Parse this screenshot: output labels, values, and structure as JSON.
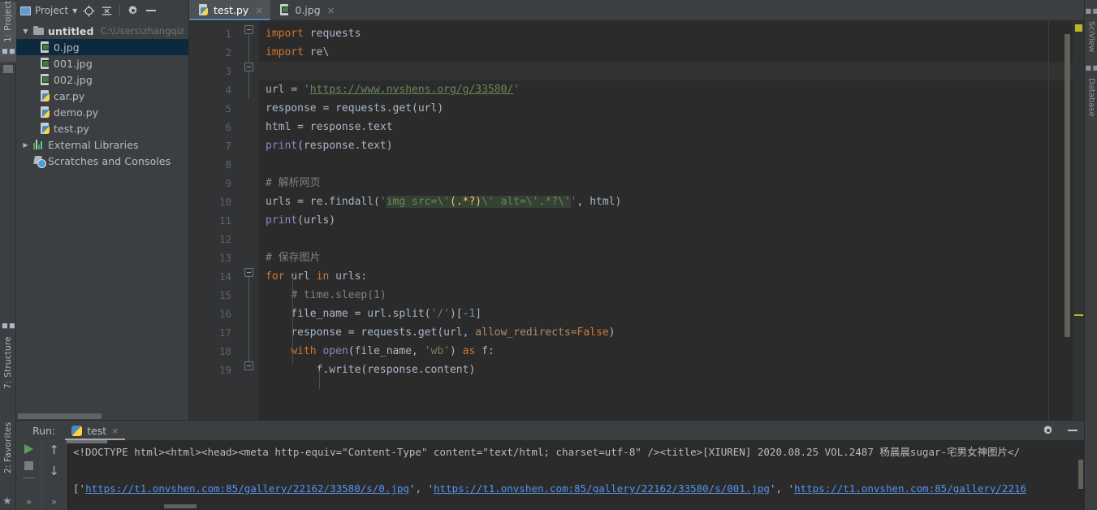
{
  "window": {
    "theme_bg": "#3c3f41",
    "editor_bg": "#2b2b2b",
    "accent": "#4a88c7"
  },
  "left_strip": {
    "tabs": [
      {
        "label": "1: Project",
        "active": true
      },
      {
        "label": "7: Structure",
        "active": false
      },
      {
        "label": "2: Favorites",
        "active": false
      }
    ]
  },
  "right_strip": {
    "tabs": [
      {
        "label": "SciView"
      },
      {
        "label": "Database"
      }
    ]
  },
  "project_panel": {
    "toolbar": {
      "title": "Project",
      "caret": "▼",
      "icons": [
        "locate-target-icon",
        "collapse-all-icon",
        "settings-gear-icon",
        "hide-panel-icon"
      ]
    },
    "tree": [
      {
        "label": "untitled",
        "path": "C:\\Users\\zhangqiz",
        "icon": "folder-icon",
        "arrow": "▼",
        "bold": true,
        "indent": 0,
        "selected": false
      },
      {
        "label": "0.jpg",
        "icon": "image-file-icon",
        "indent": 1,
        "selected": true
      },
      {
        "label": "001.jpg",
        "icon": "image-file-icon",
        "indent": 1,
        "selected": false
      },
      {
        "label": "002.jpg",
        "icon": "image-file-icon",
        "indent": 1,
        "selected": false
      },
      {
        "label": "car.py",
        "icon": "python-file-icon",
        "indent": 1,
        "selected": false
      },
      {
        "label": "demo.py",
        "icon": "python-file-icon",
        "indent": 1,
        "selected": false
      },
      {
        "label": "test.py",
        "icon": "python-file-icon",
        "indent": 1,
        "selected": false
      },
      {
        "label": "External Libraries",
        "icon": "library-icon",
        "arrow": "▶",
        "indent": 0,
        "selected": false
      },
      {
        "label": "Scratches and Consoles",
        "icon": "scratches-icon",
        "indent": 0,
        "selected": false
      }
    ]
  },
  "editor": {
    "tabs": [
      {
        "label": "test.py",
        "icon": "python-file-icon",
        "active": true,
        "close": "×"
      },
      {
        "label": "0.jpg",
        "icon": "image-file-icon",
        "active": false,
        "close": "×"
      }
    ],
    "line_numbers": [
      "1",
      "2",
      "3",
      "4",
      "5",
      "6",
      "7",
      "8",
      "9",
      "10",
      "11",
      "12",
      "13",
      "14",
      "15",
      "16",
      "17",
      "18",
      "19"
    ],
    "lines": [
      "import requests",
      "import re\\",
      "",
      "url = 'https://www.nvshens.org/g/33580/'",
      "response = requests.get(url)",
      "html = response.text",
      "print(response.text)",
      "",
      "# 解析网页",
      "urls = re.findall('img src=\\'(.*?)\\' alt=\\'.*?\\'', html)",
      "print(urls)",
      "",
      "# 保存图片",
      "for url in urls:",
      "    # time.sleep(1)",
      "    file_name = url.split('/')[-1]",
      "    response = requests.get(url, allow_redirects=False)",
      "    with open(file_name, 'wb') as f:",
      "        f.write(response.content)"
    ]
  },
  "run_panel": {
    "label": "Run:",
    "tab": {
      "label": "test",
      "icon": "python-file-icon",
      "close": "×"
    },
    "controls": [
      "run-icon",
      "stop-icon",
      "soft-wrap-icon",
      "scroll-up-icon",
      "scroll-down-icon",
      "expand-more-icon"
    ],
    "header_icons": [
      "settings-gear-icon",
      "hide-panel-icon"
    ],
    "console": {
      "line1": "<!DOCTYPE html><html><head><meta http-equiv=\"Content-Type\" content=\"text/html; charset=utf-8\" /><title>[XIUREN] 2020.08.25 VOL.2487 杨晨晨sugar-宅男女神图片</",
      "line2_prefix": "['",
      "line2_links": [
        "https://t1.onvshen.com:85/gallery/22162/33580/s/0.jpg",
        "https://t1.onvshen.com:85/gallery/22162/33580/s/001.jpg",
        "https://t1.onvshen.com:85/gallery/2216"
      ],
      "line2_sep": "', '"
    }
  }
}
